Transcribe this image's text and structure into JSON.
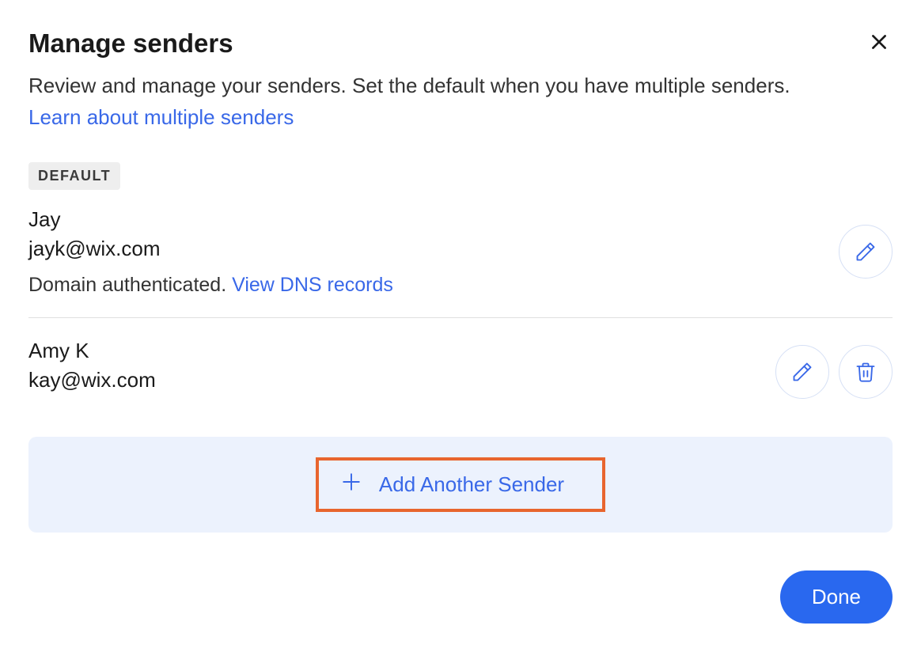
{
  "header": {
    "title": "Manage senders",
    "subtitle_prefix": "Review and manage your senders. Set the default when you have multiple senders. ",
    "learn_link": "Learn about multiple senders"
  },
  "badges": {
    "default": "DEFAULT"
  },
  "senders": [
    {
      "name": "Jay",
      "email": "jayk@wix.com",
      "status_prefix": "Domain authenticated. ",
      "status_link": "View DNS records",
      "is_default": true
    },
    {
      "name": "Amy K",
      "email": "kay@wix.com",
      "is_default": false
    }
  ],
  "actions": {
    "add_sender": "Add Another Sender",
    "done": "Done"
  }
}
